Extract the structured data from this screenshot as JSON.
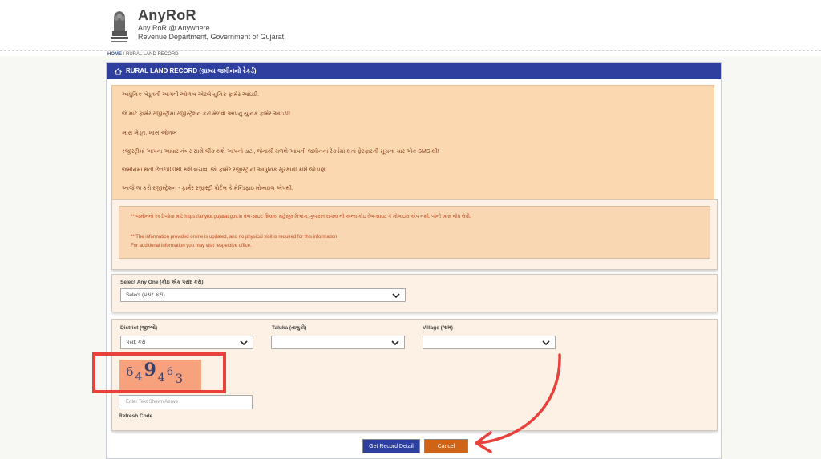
{
  "header": {
    "brand_name": "AnyRoR",
    "brand_tagline": "Any RoR @ Anywhere",
    "brand_department": "Revenue Department, Government of Gujarat"
  },
  "breadcrumb": {
    "home": "HOME",
    "current": "RURAL LAND RECORD"
  },
  "panel": {
    "title": "RURAL LAND RECORD (ગ્રામ્ય જમીનનો રેકર્ડ)"
  },
  "notice": {
    "line1": "આધુનિક ખેડૂતની આગવી ઓળખ એટલે યુનિક ફાર્મર આઇડી.",
    "line2": "જે માટે ફાર્મર રજીસ્ટ્રીમાં રજીસ્ટ્રેશન કરી મેળવો આપનું યુનિક ફાર્મર આઇડી!",
    "line3": "ખાસ ખેડૂત, ખાસ ઓળખ",
    "line4": "રજીસ્ટ્રીમાં આપના આધાર નંબર સાથે લીંક થશે આપનો ડાટા, જેનાથી મળશે આપની જમીનનાં રેકર્ડમાં થતાં ફેરફારની સૂચના ચાર એક SMS થી!",
    "line5": "જમીનમાં થતી છેતરપીંડીથી થશે બચાવ, જો ફાર્મર રજીસ્ટ્રીની આધુનિક સુરક્ષાથી થશે જોડાણ!",
    "line6_prefix": "આજે જ કરો રજીસ્ટ્રેશન - ",
    "line6_link1": "ફાર્મર રજીસ્ટ્રી પોર્ટલ",
    "line6_mid": " કે ",
    "line6_link2": "મેન્ડિફાઇ મોબાઇલ એપથી."
  },
  "info": {
    "line1": "** જમીનનો રેકર્ડ જોવા માટે https://anyror.gujarat.gov.in વેબ-સાઇટ સિવાય મહેસૂલ વિભાગ, ગુજરાત રાજ્ય ની અન્ય કોઇ વેબ-સાઇટ કે મોબાઇલ એપ નથી. જેની ખાસ નોંધ લેવી.",
    "line2": "** The information provided online is updated, and no physical visit is required for this information.",
    "line3": "For additional information you may visit respective office."
  },
  "select_any": {
    "label": "Select Any One (કોઇ એક પસંદ કરો)",
    "value": "Select (પસંદ કરો)"
  },
  "district": {
    "label": "District (જીલ્લો)",
    "value": "પસંદ કરો"
  },
  "taluka": {
    "label": "Taluka (તાલુકો)",
    "value": ""
  },
  "village": {
    "label": "Village (ગામ)",
    "value": ""
  },
  "captcha": {
    "chars": [
      "6",
      "4",
      "9",
      "4",
      "6",
      "3"
    ],
    "input_placeholder": "Enter Text Shown Above",
    "refresh_label": "Refresh Code"
  },
  "buttons": {
    "get_record": "Get Record Detail",
    "cancel": "Cancel"
  },
  "colors": {
    "title_bar": "#2f3fa0",
    "notice_bg": "#fbd8b0",
    "highlight_red": "#e8403a",
    "get_button": "#2d3f9f",
    "cancel_button": "#d06416"
  },
  "icons": {
    "panel_title_icon": "home-icon",
    "dropdown_icon": "chevron-down-icon",
    "annotation": "curved-arrow-icon"
  }
}
